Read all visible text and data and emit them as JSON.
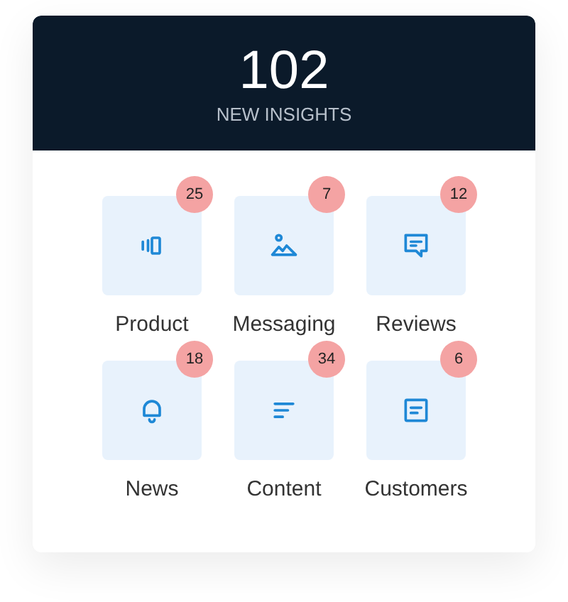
{
  "header": {
    "count": "102",
    "label": "NEW INSIGHTS"
  },
  "categories": [
    {
      "label": "Product",
      "count": "25"
    },
    {
      "label": "Messaging",
      "count": "7"
    },
    {
      "label": "Reviews",
      "count": "12"
    },
    {
      "label": "News",
      "count": "18"
    },
    {
      "label": "Content",
      "count": "34"
    },
    {
      "label": "Customers",
      "count": "6"
    }
  ]
}
